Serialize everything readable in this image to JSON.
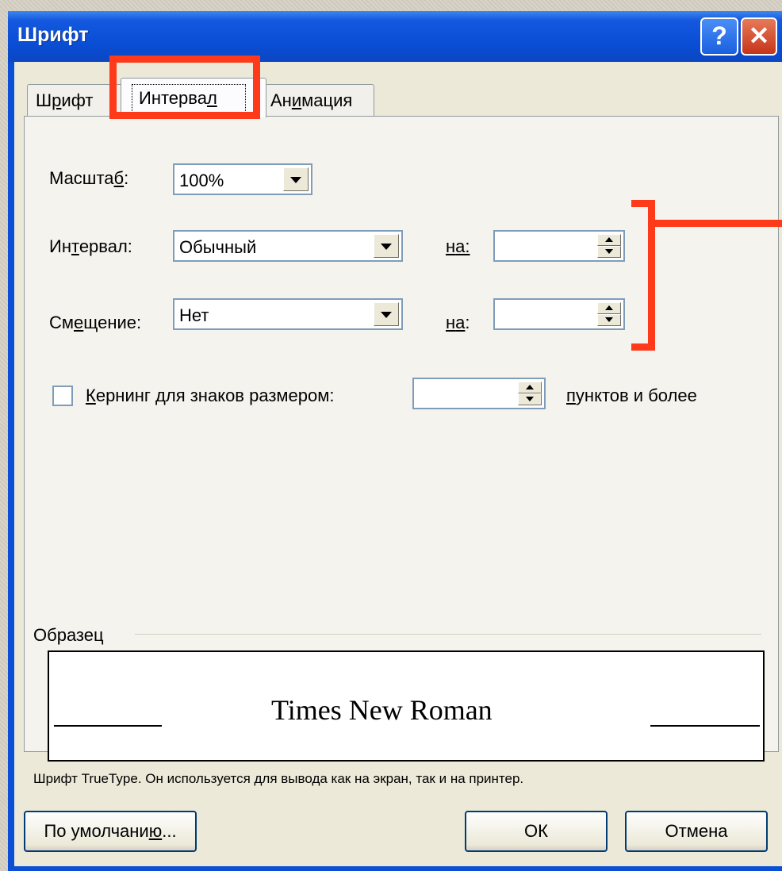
{
  "window": {
    "title": "Шрифт",
    "help_label": "?",
    "close_label": "✕"
  },
  "tabs": [
    {
      "label_pre": "Ш",
      "label_u": "р",
      "label_post": "ифт"
    },
    {
      "label_pre": "Интерва",
      "label_u": "л",
      "label_post": ""
    },
    {
      "label_pre": "Ан",
      "label_u": "и",
      "label_post": "мация"
    }
  ],
  "scale": {
    "label_pre": "Масшта",
    "label_u": "б",
    "label_post": ":",
    "value": "100%"
  },
  "spacing": {
    "label_pre": "Ин",
    "label_u": "т",
    "label_post": "ервал:",
    "value": "Обычный",
    "by_label_u": "н",
    "by_label_post": "а:",
    "by_value": ""
  },
  "position": {
    "label_pre": "См",
    "label_u": "е",
    "label_post": "щение:",
    "value": "Нет",
    "by_label_pre": "н",
    "by_label_u": "а",
    "by_label_post": ":",
    "by_value": ""
  },
  "kerning": {
    "checked": false,
    "label_u": "К",
    "label_post": "ернинг для знаков размером:",
    "value": "",
    "suffix_u": "п",
    "suffix_post": "унктов и более"
  },
  "sample": {
    "label": "Образец",
    "text": "Times New Roman",
    "note": "Шрифт TrueType. Он используется для вывода как на экран, так и на принтер."
  },
  "buttons": {
    "default_pre": "По умолчани",
    "default_u": "ю",
    "default_post": "...",
    "ok": "ОК",
    "cancel": "Отмена"
  },
  "annotation_color": "#ff3a1a"
}
